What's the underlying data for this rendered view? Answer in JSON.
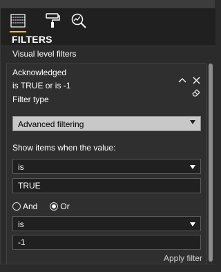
{
  "panel": {
    "title": "FILTERS",
    "tabs": [
      {
        "name": "fields-icon",
        "active": true
      },
      {
        "name": "format-paint-icon",
        "active": false
      },
      {
        "name": "analytics-icon",
        "active": false
      }
    ],
    "accent_color": "#f2c811"
  },
  "section": {
    "label": "Visual level filters"
  },
  "filter_card": {
    "field_name": "Acknowledged",
    "summary": "is TRUE or is -1",
    "filter_type_label": "Filter type",
    "filter_type_value": "Advanced filtering",
    "show_items_label": "Show items when the value:",
    "condition1": {
      "operator": "is",
      "value": "TRUE"
    },
    "logic": {
      "and_label": "And",
      "or_label": "Or",
      "selected": "Or"
    },
    "condition2": {
      "operator": "is",
      "value": "-1"
    },
    "apply_label": "Apply filter",
    "icons": [
      "collapse-icon",
      "close-icon",
      "eraser-icon"
    ]
  }
}
